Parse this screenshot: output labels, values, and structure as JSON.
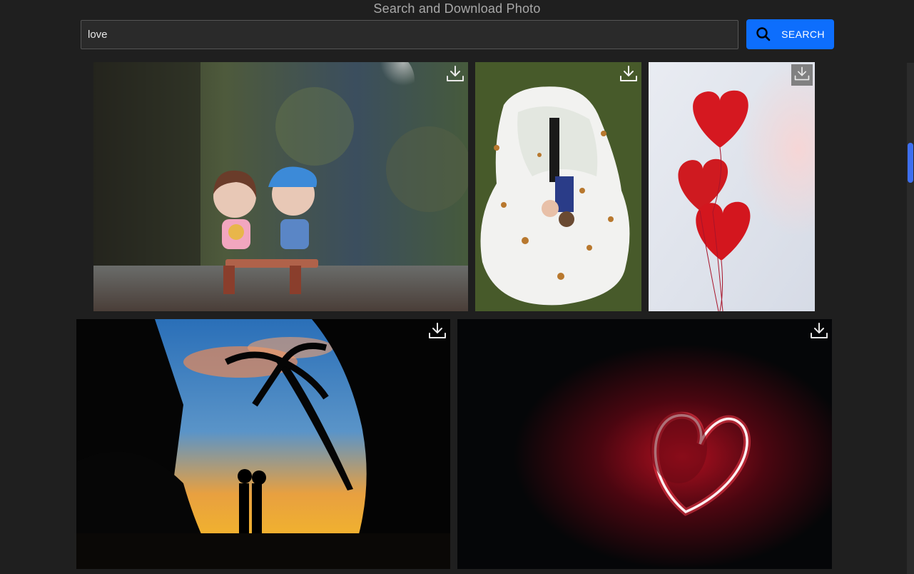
{
  "header": {
    "title": "Search and Download Photo"
  },
  "search": {
    "value": "love",
    "button_label": "SEARCH"
  },
  "theme": {
    "background": "#1f1f1f",
    "accent": "#0d6efd"
  },
  "photos": [
    {
      "subject": "toy couple on bench",
      "icon": "download-icon"
    },
    {
      "subject": "bride and groom lying on grass",
      "icon": "download-icon"
    },
    {
      "subject": "red heart balloons",
      "icon": "download-icon"
    },
    {
      "subject": "couple silhouette under palm trees at sunset",
      "icon": "download-icon"
    },
    {
      "subject": "red neon heart held in hands",
      "icon": "download-icon"
    }
  ]
}
